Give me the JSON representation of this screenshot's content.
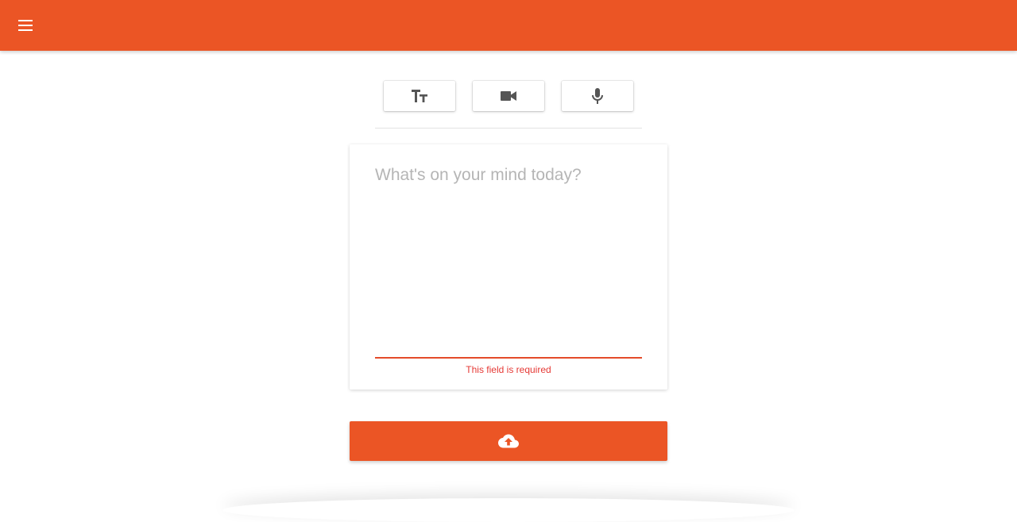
{
  "app_bar": {
    "color": "#eb5525",
    "menu_icon": "menu-icon"
  },
  "mode_tabs": [
    {
      "name": "text",
      "icon": "text-fields-icon"
    },
    {
      "name": "video",
      "icon": "videocam-icon"
    },
    {
      "name": "audio",
      "icon": "mic-icon"
    }
  ],
  "composer": {
    "placeholder": "What's on your mind today?",
    "value": "",
    "error": "This field is required",
    "error_color": "#e53935"
  },
  "upload": {
    "icon": "cloud-upload-icon",
    "color": "#eb5525"
  }
}
